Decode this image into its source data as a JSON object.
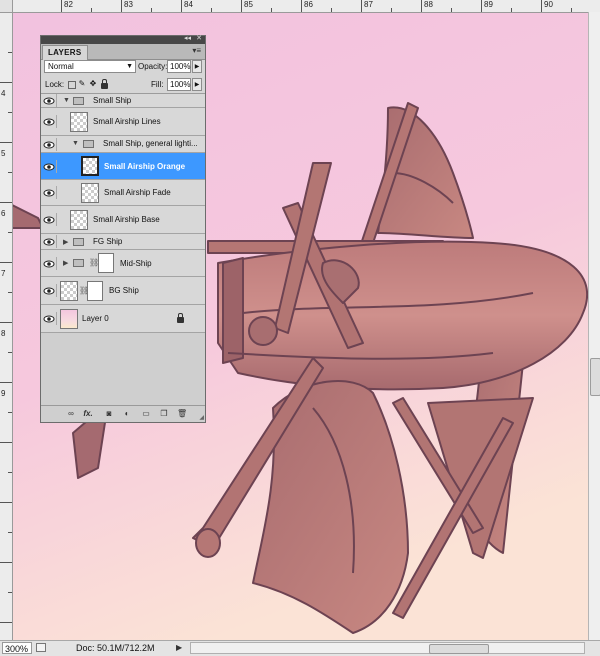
{
  "ruler": {
    "top_labels": [
      "82",
      "83",
      "84",
      "85",
      "86",
      "87",
      "88",
      "89",
      "90"
    ],
    "left_labels": [
      "4",
      "5",
      "6",
      "7",
      "8",
      "9"
    ]
  },
  "layers_panel": {
    "tab_label": "LAYERS",
    "blend_mode": "Normal",
    "opacity_label": "Opacity:",
    "opacity_value": "100%",
    "lock_label": "Lock:",
    "fill_label": "Fill:",
    "fill_value": "100%",
    "layers": [
      {
        "name": "Small Ship",
        "kind": "group",
        "expanded": true,
        "visible": true
      },
      {
        "name": "Small Airship Lines",
        "kind": "layer",
        "visible": true
      },
      {
        "name": "Small Ship, general lighti...",
        "kind": "group",
        "expanded": true,
        "visible": true
      },
      {
        "name": "Small Airship Orange",
        "kind": "layer",
        "visible": true,
        "selected": true
      },
      {
        "name": "Small Airship Fade",
        "kind": "layer",
        "visible": true
      },
      {
        "name": "Small Airship Base",
        "kind": "layer",
        "visible": true
      },
      {
        "name": "FG Ship",
        "kind": "group",
        "expanded": false,
        "visible": true
      },
      {
        "name": "Mid-Ship",
        "kind": "group-with-mask",
        "expanded": false,
        "visible": true
      },
      {
        "name": "BG Ship",
        "kind": "layer-with-mask",
        "visible": true
      },
      {
        "name": "Layer 0",
        "kind": "layer",
        "visible": true,
        "locked": true
      }
    ],
    "footer_icons": [
      "link-layers-icon",
      "fx-icon",
      "add-mask-icon",
      "adjustment-layer-icon",
      "new-group-icon",
      "new-layer-icon",
      "delete-layer-icon"
    ],
    "fx_label": "fx."
  },
  "statusbar": {
    "zoom": "300%",
    "doc_info": "Doc: 50.1M/712.2M"
  },
  "colors": {
    "canvas_pink": "#f6c6dd",
    "ship_mauve": "#b77573",
    "selection_blue": "#3d98ff"
  }
}
